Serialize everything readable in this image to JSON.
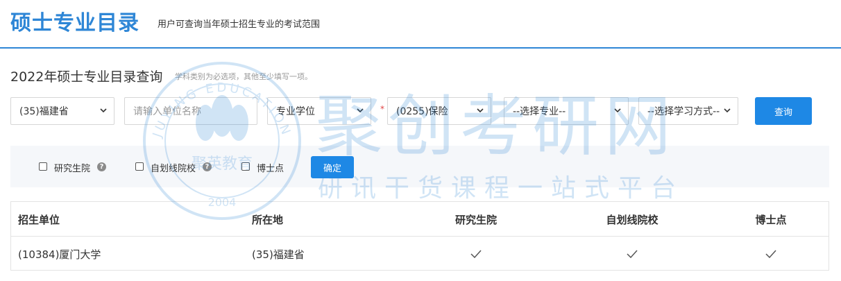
{
  "header": {
    "title": "硕士专业目录",
    "subtitle": "用户可查询当年硕士招生专业的考试范围"
  },
  "query": {
    "title": "2022年硕士专业目录查询",
    "hint": "学科类别为必选项，其他至少填写一项。",
    "province": "(35)福建省",
    "unit_placeholder": "请输入单位名称",
    "degree_type": "专业学位",
    "required_mark": "*",
    "discipline": "(0255)保险",
    "major": "--选择专业--",
    "study_mode": "--选择学习方式--",
    "search_label": "查询"
  },
  "filters": {
    "items": [
      {
        "label": "研究生院",
        "checked": false,
        "help": true
      },
      {
        "label": "自划线院校",
        "checked": false,
        "help": true
      },
      {
        "label": "博士点",
        "checked": false,
        "help": false
      }
    ],
    "confirm_label": "确定"
  },
  "table": {
    "columns": [
      "招生单位",
      "所在地",
      "研究生院",
      "自划线院校",
      "博士点"
    ],
    "rows": [
      {
        "unit": "(10384)厦门大学",
        "location": "(35)福建省",
        "graduate_school": true,
        "self_line": true,
        "doctoral": true
      }
    ]
  },
  "watermark": {
    "brand": "聚创考研网",
    "slogan": "研讯干货课程一站式平台",
    "seal_text": "聚英教育",
    "seal_ring": "JUYING EDUCATION",
    "seal_year": "2004"
  },
  "icons": {
    "caret": "chevron-down-icon",
    "help": "question-icon",
    "check": "check-icon"
  },
  "colors": {
    "accent": "#2e86d6",
    "button": "#1e88e5",
    "required": "#e04444"
  }
}
